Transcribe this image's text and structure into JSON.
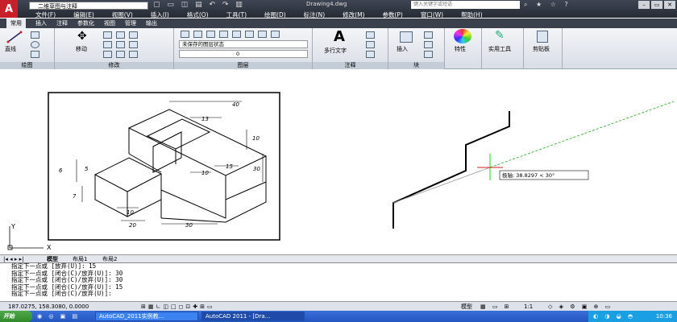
{
  "app": {
    "workspace": "二维草图与注释",
    "document_title": "Drawing4.dwg",
    "search_placeholder": "键入关键字或短语"
  },
  "menu": [
    "文件(F)",
    "编辑(E)",
    "视图(V)",
    "插入(I)",
    "格式(O)",
    "工具(T)",
    "绘图(D)",
    "标注(N)",
    "修改(M)",
    "参数(P)",
    "窗口(W)",
    "帮助(H)"
  ],
  "ribbon_tabs": [
    "常用",
    "插入",
    "注释",
    "参数化",
    "视图",
    "管理",
    "输出"
  ],
  "ribbon": {
    "draw_line": "直线",
    "draw_panel": "绘图",
    "move": "移动",
    "modify_panel": "修改",
    "layer_state": "未保存的图层状态",
    "layer_value": "0",
    "layers_panel": "图层",
    "mtext": "多行文字",
    "annotation_panel": "注释",
    "insert": "插入",
    "block_panel": "块",
    "properties": "特性",
    "utilities": "实用工具",
    "clipboard": "剪贴板"
  },
  "drawing": {
    "dims": [
      "40",
      "13",
      "6",
      "10",
      "10",
      "15",
      "30",
      "5",
      "7",
      "10",
      "20",
      "30"
    ],
    "tooltip": "极轴: 38.8297 < 30°",
    "ucs_y": "Y",
    "ucs_x": "X"
  },
  "layout_tabs": [
    "模型",
    "布局1",
    "布局2"
  ],
  "command_lines": [
    "指定下一点或 [放弃(U)]: 15",
    "指定下一点或 [闭合(C)/放弃(U)]: 30",
    "指定下一点或 [闭合(C)/放弃(U)]: 30",
    "指定下一点或 [闭合(C)/放弃(U)]: 15",
    "指定下一点或 [闭合(C)/放弃(U)]:"
  ],
  "status": {
    "coords": "187.0275, 158.3080, 0.0000",
    "model": "模型",
    "scale": "1:1"
  },
  "taskbar": {
    "start": "开始",
    "task1": "AutoCAD_2011实例教...",
    "task2": "AutoCAD 2011 - [Dra...",
    "clock": "10:36"
  }
}
